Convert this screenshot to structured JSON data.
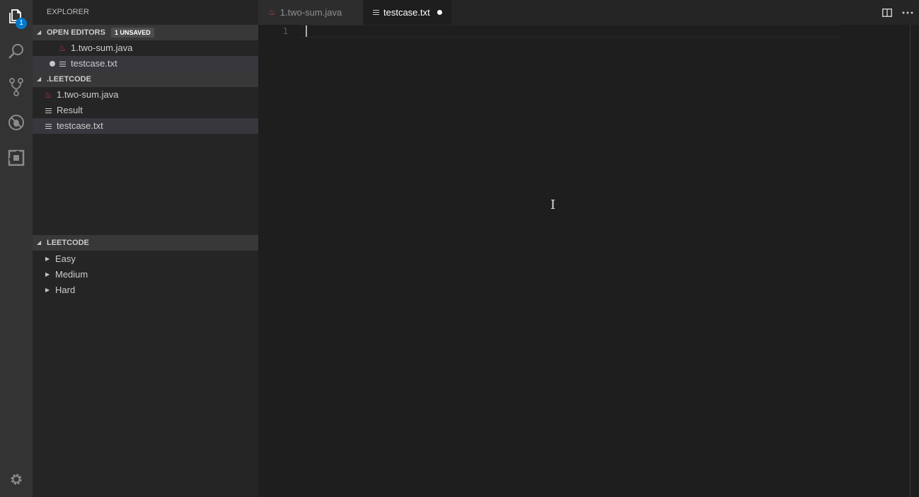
{
  "activity_bar": {
    "explorer_badge": "1"
  },
  "sidebar": {
    "title": "EXPLORER",
    "open_editors": {
      "header": "OPEN EDITORS",
      "badge": "1 UNSAVED",
      "items": [
        {
          "label": "1.two-sum.java",
          "icon": "java-icon"
        },
        {
          "label": "testcase.txt",
          "icon": "text-file-icon",
          "dirty": true
        }
      ]
    },
    "workspace": {
      "header": ".LEETCODE",
      "items": [
        {
          "label": "1.two-sum.java",
          "icon": "java-icon"
        },
        {
          "label": "Result",
          "icon": "text-file-icon"
        },
        {
          "label": "testcase.txt",
          "icon": "text-file-icon"
        }
      ]
    },
    "leetcode": {
      "header": "LEETCODE",
      "items": [
        {
          "label": "Easy"
        },
        {
          "label": "Medium"
        },
        {
          "label": "Hard"
        }
      ]
    }
  },
  "tabs": [
    {
      "label": "1.two-sum.java",
      "active": false
    },
    {
      "label": "testcase.txt",
      "active": true,
      "dirty": true
    }
  ],
  "editor": {
    "line_numbers": [
      "1"
    ]
  },
  "colors": {
    "accent": "#007acc",
    "java": "#cc3e44"
  }
}
